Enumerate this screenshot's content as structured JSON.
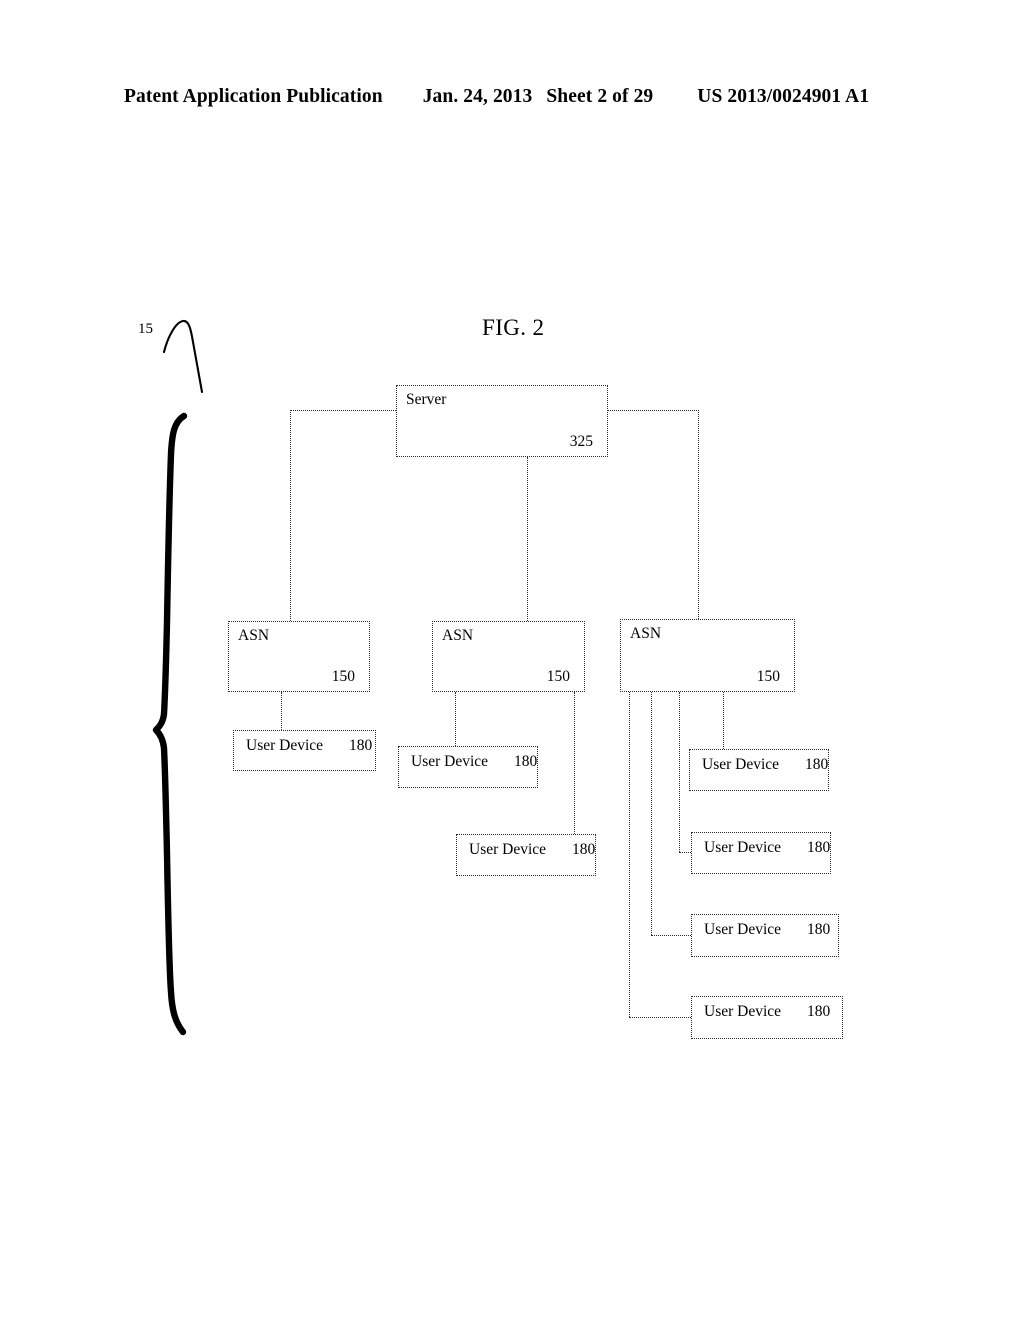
{
  "header": {
    "publication": "Patent Application Publication",
    "date": "Jan. 24, 2013",
    "sheet": "Sheet 2 of 29",
    "patent_number": "US 2013/0024901 A1"
  },
  "figure": {
    "title": "FIG. 2",
    "system_reference": "15"
  },
  "diagram": {
    "server": {
      "label": "Server",
      "ref": "325"
    },
    "asn_nodes": [
      {
        "label": "ASN",
        "ref": "150"
      },
      {
        "label": "ASN",
        "ref": "150"
      },
      {
        "label": "ASN",
        "ref": "150"
      }
    ],
    "user_devices": [
      {
        "label": "User Device",
        "ref": "180"
      },
      {
        "label": "User Device",
        "ref": "180"
      },
      {
        "label": "User Device",
        "ref": "180"
      },
      {
        "label": "User Device",
        "ref": "180"
      },
      {
        "label": "User Device",
        "ref": "180"
      },
      {
        "label": "User Device",
        "ref": "180"
      },
      {
        "label": "User Device",
        "ref": "180"
      }
    ]
  },
  "colors": {
    "ink": "#000000",
    "line": "#2b2b2b",
    "page": "#ffffff"
  }
}
